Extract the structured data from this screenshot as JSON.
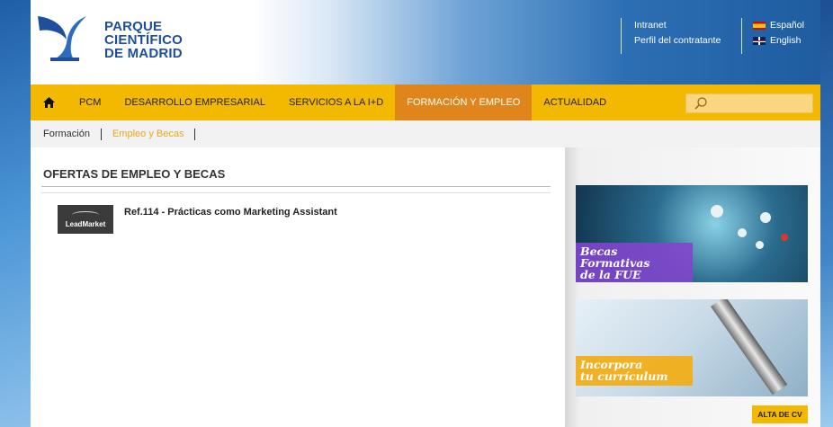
{
  "header": {
    "logo_line1": "PARQUE",
    "logo_line2": "CIENTÍFICO",
    "logo_line3": "DE MADRID",
    "top_links": [
      "Intranet",
      "Perfil del contratante"
    ],
    "languages": [
      "Español",
      "English"
    ]
  },
  "nav": {
    "items": [
      "PCM",
      "DESARROLLO EMPRESARIAL",
      "SERVICIOS A LA I+D",
      "FORMACIÓN Y EMPLEO",
      "ACTUALIDAD"
    ],
    "active_index": 3,
    "search_placeholder": ""
  },
  "subnav": {
    "items": [
      "Formación",
      "Empleo y Becas"
    ],
    "selected_index": 1
  },
  "main": {
    "section_title": "OFERTAS DE EMPLEO Y BECAS",
    "jobs": [
      {
        "logo_text": "LeadMarket",
        "title": "Ref.114 - Prácticas como Marketing Assistant"
      }
    ]
  },
  "sidebar": {
    "banner1_line1": "Becas Formativas",
    "banner1_line2": "de la FUE",
    "banner2_line1": "Incorpora",
    "banner2_line2": "tu currículum",
    "button_label": "ALTA DE CV"
  },
  "colors": {
    "nav_bg": "#f3b800",
    "nav_active": "#e0851b",
    "brand_blue": "#1d4f9b",
    "subnav_selected": "#e8a81f"
  }
}
